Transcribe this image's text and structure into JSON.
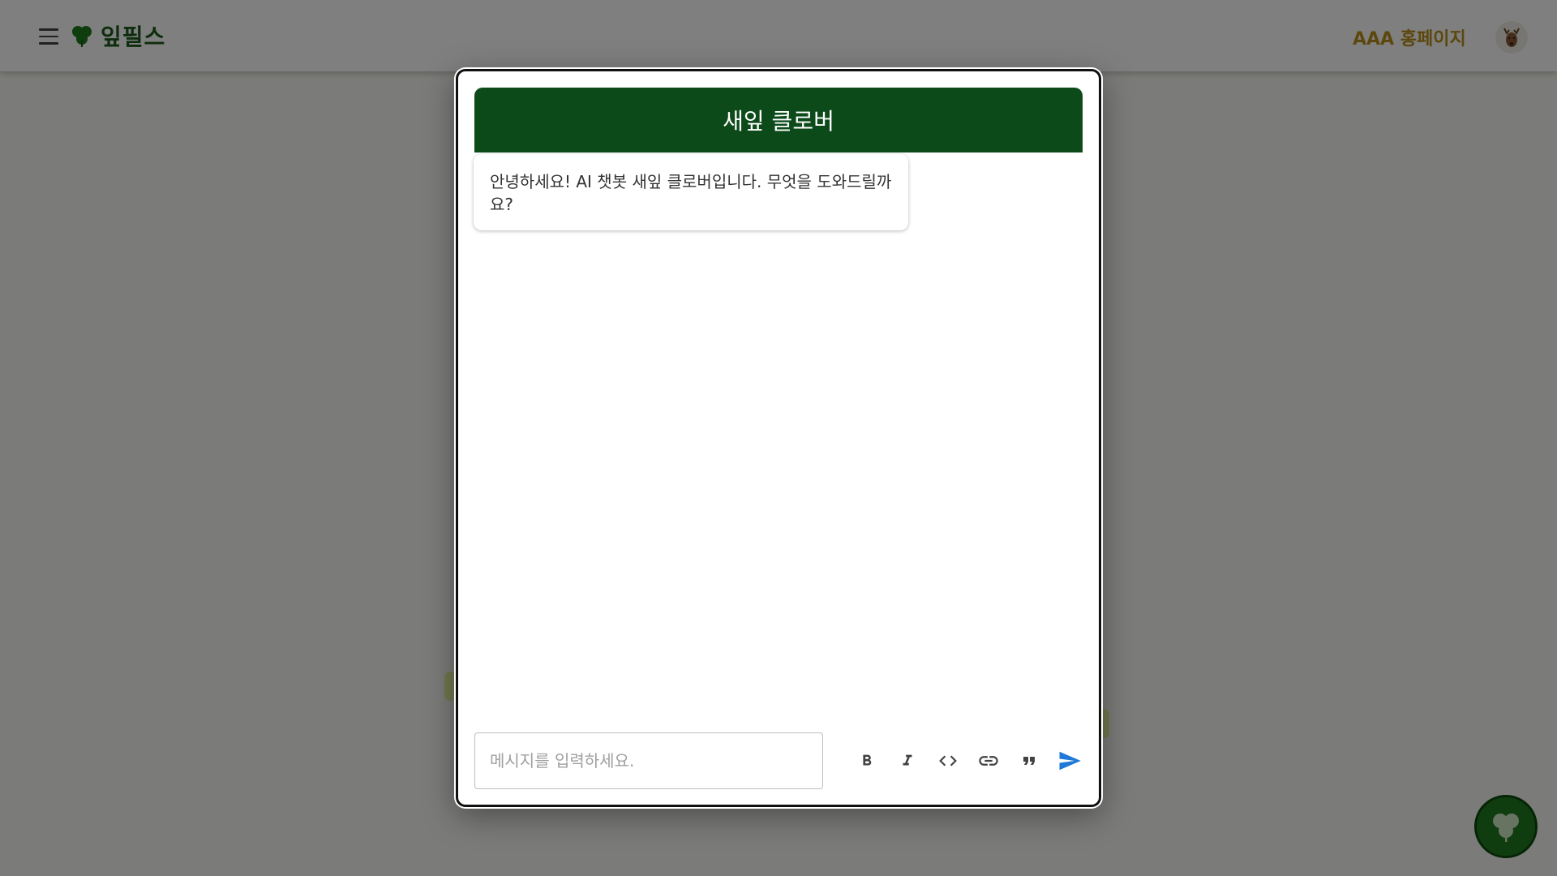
{
  "app": {
    "brand_name": "잎필스",
    "header_link": "AAA 홍페이지"
  },
  "chat": {
    "title": "새잎 클로버",
    "welcome_message": "안녕하세요! AI 챗봇 새잎 클로버입니다. 무엇을 도와드릴까요?",
    "input_placeholder": "메시지를 입력하세요.",
    "input_value": ""
  },
  "toolbar": {
    "items": [
      "bold-icon",
      "italic-icon",
      "code-icon",
      "link-icon",
      "quote-icon",
      "send-icon"
    ]
  },
  "colors": {
    "header_bg": "#0c4a1a",
    "send_icon": "#1e7ad6",
    "brand_green": "#1c5a1c",
    "link_gold": "#b88f1a",
    "scrim": "rgba(0,0,0,0.5)"
  }
}
